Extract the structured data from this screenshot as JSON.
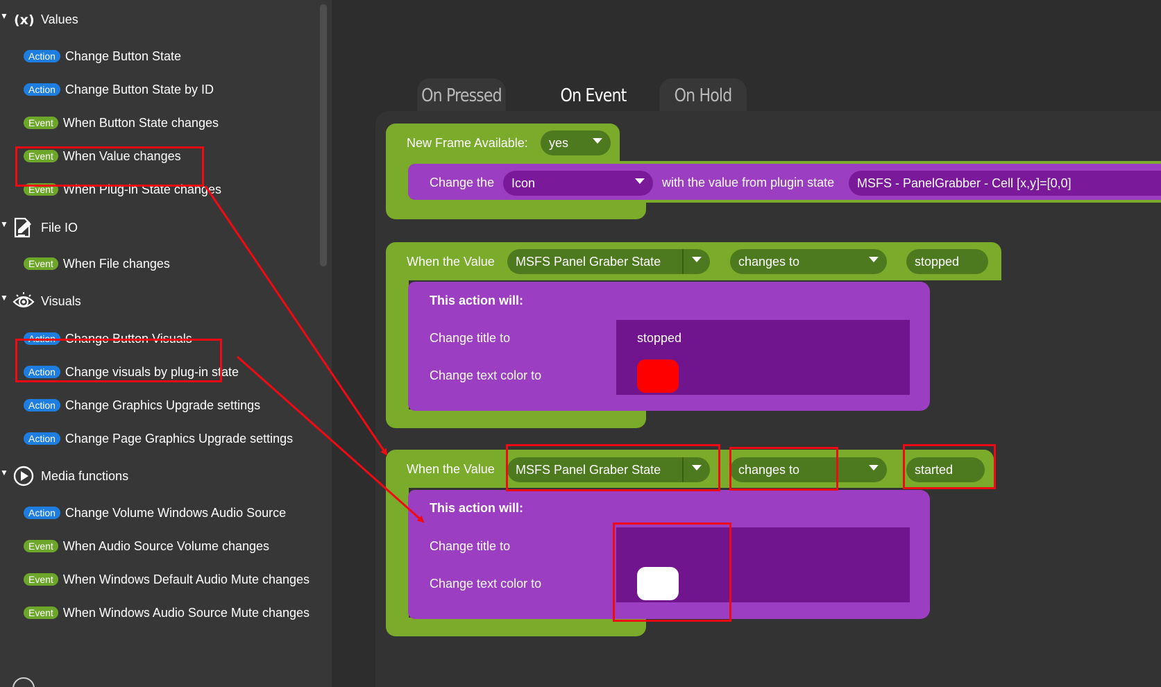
{
  "sidebar": {
    "categories": [
      {
        "label": "Values",
        "icon": "variable-x-icon"
      },
      {
        "label": "File IO",
        "icon": "file-edit-icon"
      },
      {
        "label": "Visuals",
        "icon": "eye-icon"
      },
      {
        "label": "Media functions",
        "icon": "play-circle-icon"
      }
    ],
    "items": [
      {
        "type": "Action",
        "label": "Change Button State"
      },
      {
        "type": "Action",
        "label": "Change Button State by ID"
      },
      {
        "type": "Event",
        "label": "When Button State changes"
      },
      {
        "type": "Event",
        "label": "When Value changes"
      },
      {
        "type": "Event",
        "label": "When Plug-in State changes"
      },
      {
        "type": "Event",
        "label": "When File changes"
      },
      {
        "type": "Action",
        "label": "Change Button Visuals"
      },
      {
        "type": "Action",
        "label": "Change visuals by plug-in state"
      },
      {
        "type": "Action",
        "label": "Change Graphics Upgrade settings"
      },
      {
        "type": "Action",
        "label": "Change Page Graphics Upgrade settings"
      },
      {
        "type": "Action",
        "label": "Change Volume Windows Audio Source"
      },
      {
        "type": "Event",
        "label": "When Audio Source Volume changes"
      },
      {
        "type": "Event",
        "label": "When Windows Default Audio Mute changes"
      },
      {
        "type": "Event",
        "label": "When Windows Audio Source Mute changes"
      }
    ]
  },
  "tabs": [
    {
      "label": "On Pressed",
      "active": false
    },
    {
      "label": "On Event",
      "active": true
    },
    {
      "label": "On Hold",
      "active": false
    }
  ],
  "block1": {
    "header_label": "New Frame Available:",
    "header_value": "yes",
    "change_label": "Change the",
    "target_value": "Icon",
    "with_label": "with the value from plugin state",
    "state_value": "MSFS - PanelGrabber - Cell [x,y]=[0,0]"
  },
  "block2": {
    "when_label": "When the Value",
    "value_name": "MSFS Panel Graber State",
    "condition": "changes to",
    "target": "stopped",
    "action_header": "This action will:",
    "title_label": "Change title to",
    "title_value": "stopped",
    "color_label": "Change text color to",
    "color": "#ff0000"
  },
  "block3": {
    "when_label": "When the Value",
    "value_name": "MSFS Panel Graber State",
    "condition": "changes to",
    "target": "started",
    "action_header": "This action will:",
    "title_label": "Change title to",
    "title_value": "",
    "color_label": "Change text color to",
    "color": "#ffffff"
  },
  "colors": {
    "block_green": "#7aab2a",
    "block_purple": "#9b3ec1",
    "action_badge": "#1e7ee0",
    "event_badge": "#6da72a",
    "annotation_red": "#f00a14"
  }
}
